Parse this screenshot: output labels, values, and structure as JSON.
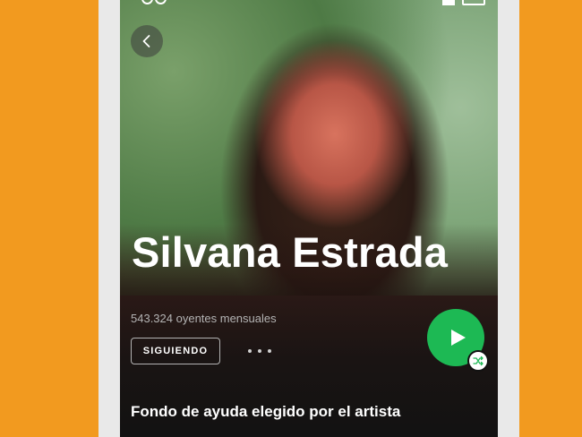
{
  "artist": {
    "name": "Silvana Estrada",
    "monthly_listeners": "543.324 oyentes mensuales"
  },
  "actions": {
    "follow_label": "SIGUIENDO",
    "more_icon": "ellipsis-horizontal-icon",
    "play_icon": "play-icon",
    "shuffle_icon": "shuffle-icon",
    "back_icon": "chevron-left-icon"
  },
  "sections": {
    "artist_pick_title": "Fondo de ayuda elegido por el artista"
  },
  "colors": {
    "background": "#f29a1f",
    "play_button": "#1db954",
    "screen": "#121212"
  }
}
